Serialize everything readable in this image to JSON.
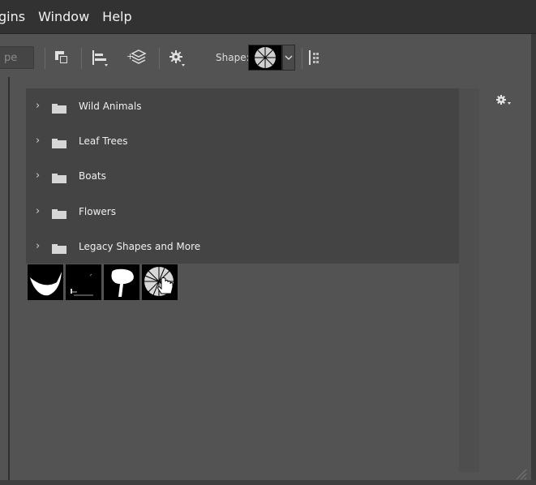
{
  "menubar": {
    "items": [
      {
        "label": "gins"
      },
      {
        "label": "Window"
      },
      {
        "label": "Help"
      }
    ]
  },
  "options_bar": {
    "mode_field_text": "pe",
    "shape_label": "Shape:",
    "icons": [
      "arrange-shapes-icon",
      "align-icon",
      "combine-layers-icon",
      "gear-icon",
      "path-options-icon"
    ]
  },
  "shapes_panel": {
    "groups": [
      {
        "label": "Wild Animals"
      },
      {
        "label": "Leaf Trees"
      },
      {
        "label": "Boats"
      },
      {
        "label": "Flowers"
      },
      {
        "label": "Legacy Shapes and More"
      }
    ],
    "thumbnails": [
      "fish-shape-thumb",
      "grass-shape-thumb",
      "tree-shape-thumb",
      "starburst-shape-thumb"
    ],
    "hovered_thumbnail": "starburst-shape-thumb"
  },
  "colors": {
    "panel_bg": "#535353",
    "menubar_bg": "#323232",
    "tree_bg": "#444444"
  }
}
